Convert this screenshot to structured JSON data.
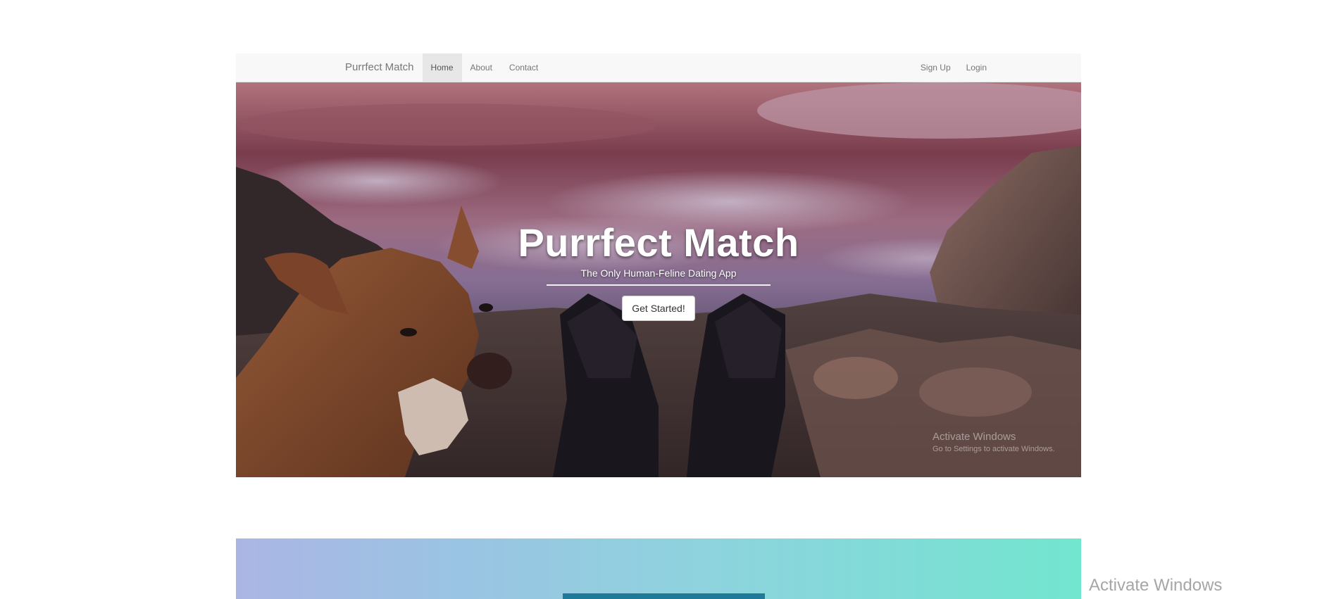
{
  "navbar": {
    "brand": "Purrfect Match",
    "left_links": [
      {
        "label": "Home",
        "active": true
      },
      {
        "label": "About",
        "active": false
      },
      {
        "label": "Contact",
        "active": false
      }
    ],
    "right_links": [
      {
        "label": "Sign Up"
      },
      {
        "label": "Login"
      }
    ]
  },
  "hero": {
    "title": "Purrfect Match",
    "subtitle": "The Only Human-Feline Dating App",
    "cta_label": "Get Started!"
  },
  "os_watermark": {
    "inner_title": "Activate Windows",
    "inner_subtitle": "Go to Settings to activate Windows.",
    "outer_title": "Activate Windows"
  },
  "colors": {
    "navbar_bg": "#f8f8f8",
    "active_link_bg": "#e7e7e7",
    "gradient_start": "#abb5e4",
    "gradient_end": "#72e6cf"
  }
}
